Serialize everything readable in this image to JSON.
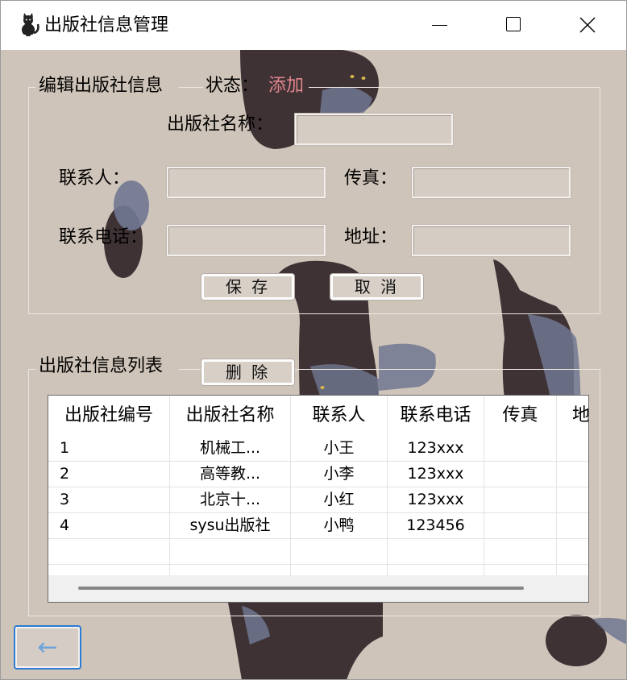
{
  "window": {
    "title": "出版社信息管理",
    "icon": "cat-icon",
    "controls": {
      "minimize": "minimize-icon",
      "maximize": "maximize-icon",
      "close": "close-icon"
    }
  },
  "edit_group": {
    "title": "编辑出版社信息",
    "status_label": "状态：",
    "status_value": "添加",
    "fields": {
      "name": {
        "label": "出版社名称：",
        "value": ""
      },
      "contact": {
        "label": "联系人：",
        "value": ""
      },
      "fax": {
        "label": "传真：",
        "value": ""
      },
      "phone": {
        "label": "联系电话：",
        "value": ""
      },
      "address": {
        "label": "地址：",
        "value": ""
      }
    },
    "save_label": "保 存",
    "cancel_label": "取 消"
  },
  "list_group": {
    "title": "出版社信息列表",
    "delete_label": "删 除",
    "columns": [
      "出版社编号",
      "出版社名称",
      "联系人",
      "联系电话",
      "传真",
      "地"
    ],
    "rows": [
      [
        "1",
        "机械工...",
        "小王",
        "123xxx",
        "",
        ""
      ],
      [
        "2",
        "高等教...",
        "小李",
        "123xxx",
        "",
        ""
      ],
      [
        "3",
        "北京十...",
        "小红",
        "123xxx",
        "",
        ""
      ],
      [
        "4",
        "sysu出版社",
        "小鸭",
        "123456",
        "",
        ""
      ]
    ]
  },
  "back_button": {
    "icon": "arrow-left-icon",
    "glyph": "←"
  },
  "colors": {
    "background": "#cfc4b9",
    "status_text": "#e3868c",
    "focus_border": "#2c7cd3",
    "back_arrow": "#6ea3dc"
  }
}
